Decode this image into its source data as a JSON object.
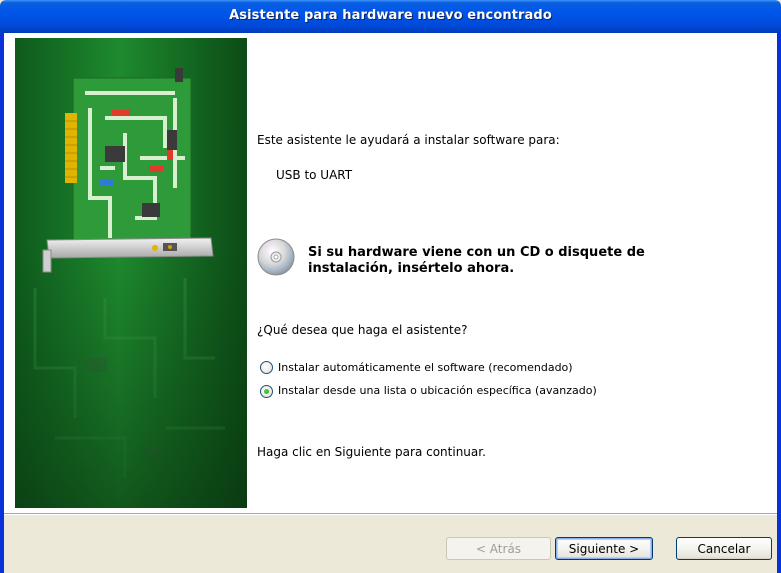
{
  "window": {
    "title": "Asistente para hardware nuevo encontrado"
  },
  "content": {
    "intro": "Este asistente le ayudará a instalar software para:",
    "device_name": "USB to UART",
    "cd_prompt_line1": "Si su hardware viene con un CD o disquete de",
    "cd_prompt_line2": "instalación, insértelo ahora.",
    "question": "¿Qué desea que haga el asistente?",
    "options": [
      {
        "label": "Instalar automáticamente el software (recomendado)",
        "selected": false
      },
      {
        "label": "Instalar desde una lista o ubicación específica (avanzado)",
        "selected": true
      }
    ],
    "continue_hint": "Haga clic en Siguiente para continuar."
  },
  "buttons": {
    "back": "< Atrás",
    "next": "Siguiente >",
    "cancel": "Cancelar"
  },
  "colors": {
    "titlebar": "#0055ea",
    "sidebar_green": "#1f8a2e",
    "window_bg": "#ece9d8"
  },
  "icons": {
    "sidebar": "hardware-card-icon",
    "cd": "cd-icon"
  }
}
